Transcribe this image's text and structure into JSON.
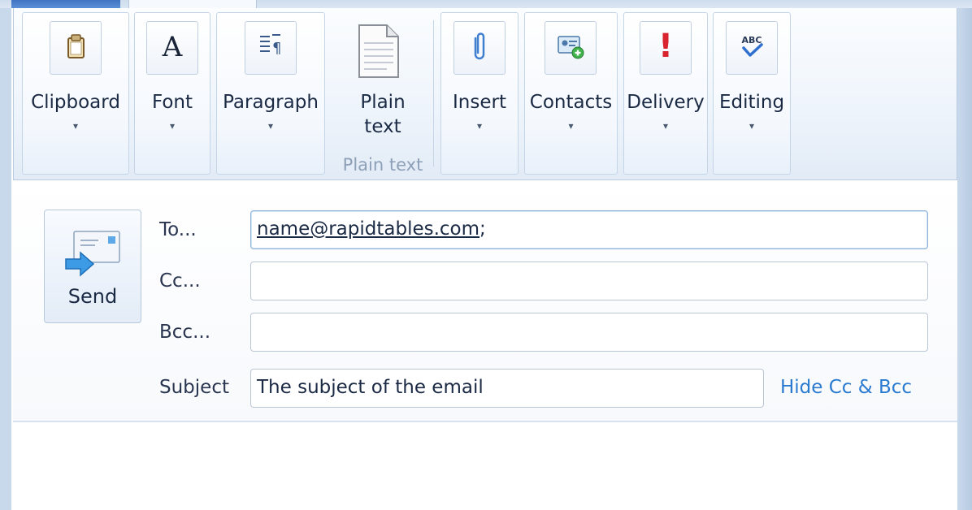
{
  "ribbon": {
    "groups": [
      {
        "label": "Clipboard",
        "icon": "clipboard-icon"
      },
      {
        "label": "Font",
        "icon": "font-icon"
      },
      {
        "label": "Paragraph",
        "icon": "paragraph-icon"
      },
      {
        "label": "Insert",
        "icon": "paperclip-icon"
      },
      {
        "label": "Contacts",
        "icon": "add-contact-icon"
      },
      {
        "label": "Delivery",
        "icon": "priority-icon"
      },
      {
        "label": "Editing",
        "icon": "spellcheck-icon"
      }
    ],
    "plain_text": {
      "label_line1": "Plain",
      "label_line2": "text",
      "caption": "Plain text"
    },
    "dropdown_glyph": "▾",
    "font_glyph": "A",
    "priority_glyph": "!",
    "spell_glyph": "ABC"
  },
  "compose": {
    "send_label": "Send",
    "to_label": "To...",
    "cc_label": "Cc...",
    "bcc_label": "Bcc...",
    "subject_label": "Subject",
    "to_value": "name@rapidtables.com",
    "to_separator": ";",
    "cc_value": "",
    "bcc_value": "",
    "subject_value": "The subject of the email",
    "hide_link": "Hide Cc & Bcc"
  },
  "colors": {
    "accent": "#2a7bd0",
    "tab_active": "#3f74c2",
    "priority_red": "#d9232e"
  }
}
